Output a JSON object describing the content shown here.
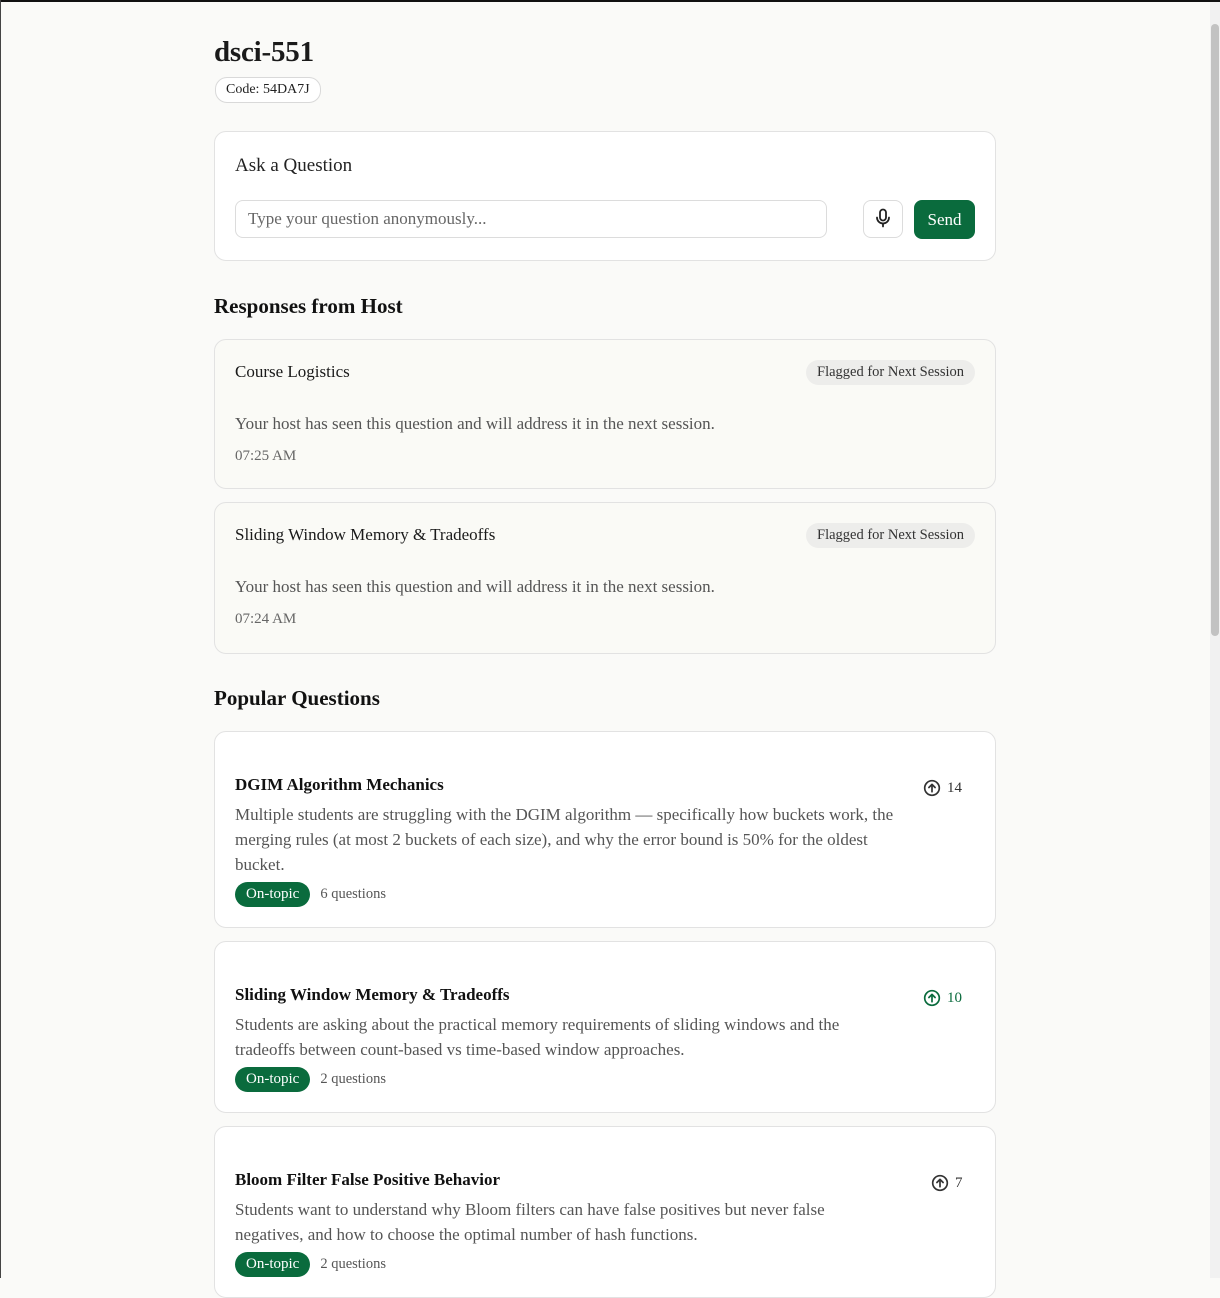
{
  "session": {
    "title": "dsci-551",
    "code_label": "Code: 54DA7J"
  },
  "ask": {
    "title": "Ask a Question",
    "placeholder": "Type your question anonymously...",
    "mic_icon": "microphone-icon",
    "send_label": "Send"
  },
  "responses": {
    "heading": "Responses from Host",
    "items": [
      {
        "title": "Course Logistics",
        "status": "Flagged for Next Session",
        "message": "Your host has seen this question and will address it in the next session.",
        "time": "07:25 AM"
      },
      {
        "title": "Sliding Window Memory & Tradeoffs",
        "status": "Flagged for Next Session",
        "message": "Your host has seen this question and will address it in the next session.",
        "time": "07:24 AM"
      }
    ]
  },
  "popular": {
    "heading": "Popular Questions",
    "items": [
      {
        "title": "DGIM Algorithm Mechanics",
        "description": "Multiple students are struggling with the DGIM algorithm — specifically how buckets work, the merging rules (at most 2 buckets of each size), and why the error bound is 50% for the oldest bucket.",
        "tag": "On-topic",
        "count": "6 questions",
        "votes": "14",
        "voted": false
      },
      {
        "title": "Sliding Window Memory & Tradeoffs",
        "description": "Students are asking about the practical memory requirements of sliding windows and the tradeoffs between count-based vs time-based window approaches.",
        "tag": "On-topic",
        "count": "2 questions",
        "votes": "10",
        "voted": true
      },
      {
        "title": "Bloom Filter False Positive Behavior",
        "description": "Students want to understand why Bloom filters can have false positives but never false negatives, and how to choose the optimal number of hash functions.",
        "tag": "On-topic",
        "count": "2 questions",
        "votes": "7",
        "voted": false
      }
    ]
  },
  "colors": {
    "accent": "#0a6b3d",
    "background": "#fafaf8",
    "response_card": "#fafaf6"
  }
}
